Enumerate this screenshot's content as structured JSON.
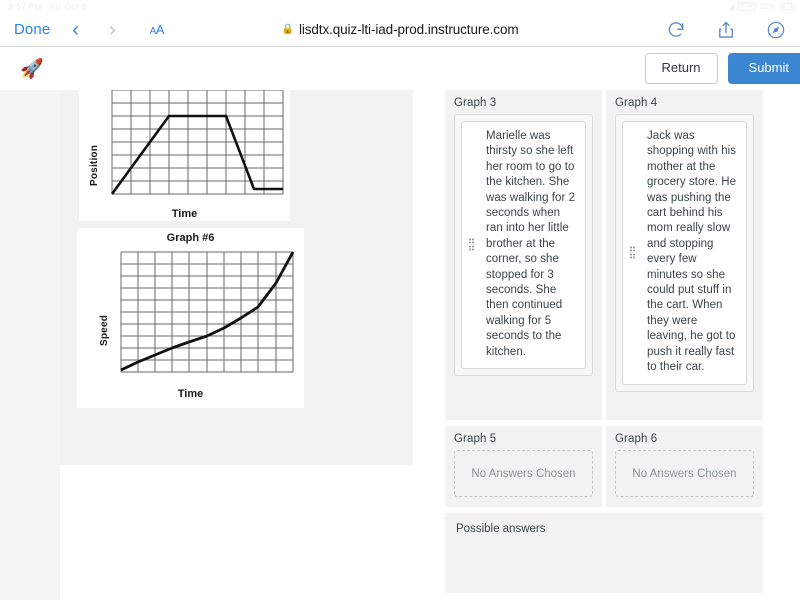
{
  "status_bar": {
    "time": "3:57 PM",
    "date": "Fri Oct 9",
    "battery_percent": "21%",
    "wifi_icon": "wifi-icon",
    "battery_icon": "battery-icon"
  },
  "browser": {
    "done_label": "Done",
    "back_icon": "chevron-left-icon",
    "forward_icon": "chevron-right-icon",
    "text_size_label": "AA",
    "lock_icon": "lock-icon",
    "url": "lisdtx.quiz-lti-iad-prod.instructure.com",
    "reload_icon": "reload-icon",
    "share_icon": "share-icon",
    "compass_icon": "compass-icon",
    "accent_color": "#2d7ff0"
  },
  "quiz_header": {
    "logo_icon": "rocket-icon",
    "return_label": "Return",
    "submit_label": "Submit",
    "submit_color": "#3b86d1"
  },
  "graphs": [
    {
      "title": "",
      "ylabel": "Position",
      "xlabel": "Time"
    },
    {
      "title": "Graph #6",
      "ylabel": "Speed",
      "xlabel": "Time"
    }
  ],
  "chart_data": [
    {
      "type": "line",
      "title": "",
      "xlabel": "Time",
      "ylabel": "Position",
      "grid": true,
      "xlim": [
        0,
        10
      ],
      "ylim": [
        0,
        9
      ],
      "x": [
        0,
        3,
        6,
        8,
        10
      ],
      "y": [
        0,
        7,
        7,
        0.2,
        0.2
      ],
      "description": "Position rises linearly, holds constant, drops steeply, then stays flat"
    },
    {
      "type": "line",
      "title": "Graph #6",
      "xlabel": "Time",
      "ylabel": "Speed",
      "grid": true,
      "xlim": [
        0,
        10
      ],
      "ylim": [
        0,
        10
      ],
      "x": [
        0,
        1,
        2,
        3,
        4,
        5,
        6,
        7,
        8,
        9,
        10
      ],
      "y": [
        0.2,
        0.9,
        1.5,
        2.1,
        2.6,
        3.1,
        3.6,
        4.4,
        5.3,
        7.4,
        9.9
      ],
      "description": "Speed increases slowly then accelerates upward, concave up curve"
    }
  ],
  "answer_cells": [
    {
      "label": "Graph 3",
      "has_answer": true,
      "grip_icon": "drag-handle-icon",
      "answer_text": "Marielle was thirsty so she left her room to go to the kitchen. She was walking for 2 seconds when ran into her little brother at the corner, so she stopped for 3 seconds. She then continued walking for 5 seconds to the kitchen."
    },
    {
      "label": "Graph 4",
      "has_answer": true,
      "grip_icon": "drag-handle-icon",
      "answer_text": "Jack was shopping with his mother at the grocery store. He was pushing the cart behind his mom really slow and stopping every few minutes so she could put stuff in the cart. When they were leaving, he got to push it really fast to their car."
    },
    {
      "label": "Graph 5",
      "has_answer": false,
      "empty_text": "No Answers Chosen"
    },
    {
      "label": "Graph 6",
      "has_answer": false,
      "empty_text": "No Answers Chosen"
    }
  ],
  "possible_answers": {
    "label": "Possible answers"
  }
}
